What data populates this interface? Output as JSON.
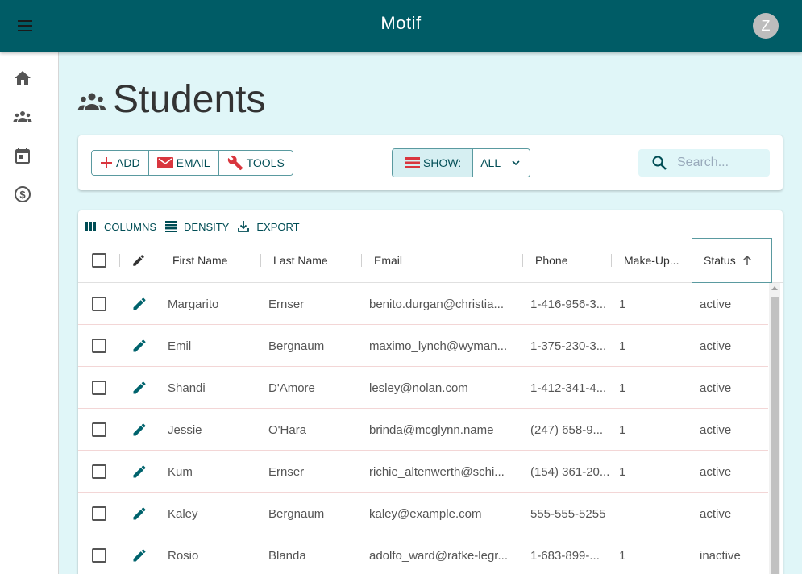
{
  "app": {
    "title": "Motif",
    "user_initial": "Z"
  },
  "sidebar": {
    "items": [
      {
        "icon": "home-icon"
      },
      {
        "icon": "people-icon"
      },
      {
        "icon": "calendar-icon"
      },
      {
        "icon": "dollar-icon"
      }
    ]
  },
  "page": {
    "title": "Students",
    "icon": "people-icon"
  },
  "toolbar": {
    "add_label": "ADD",
    "email_label": "EMAIL",
    "tools_label": "TOOLS",
    "show_label": "SHOW:",
    "show_value": "ALL",
    "search_placeholder": "Search..."
  },
  "grid_tools": {
    "columns_label": "COLUMNS",
    "density_label": "DENSITY",
    "export_label": "EXPORT"
  },
  "table": {
    "headers": {
      "first_name": "First Name",
      "last_name": "Last Name",
      "email": "Email",
      "phone": "Phone",
      "makeup": "Make-Up...",
      "status": "Status"
    },
    "rows": [
      {
        "first": "Margarito",
        "last": "Ernser",
        "email": "benito.durgan@christia...",
        "phone": "1-416-956-3...",
        "makeup": "1",
        "status": "active"
      },
      {
        "first": "Emil",
        "last": "Bergnaum",
        "email": "maximo_lynch@wyman...",
        "phone": "1-375-230-3...",
        "makeup": "1",
        "status": "active"
      },
      {
        "first": "Shandi",
        "last": "D'Amore",
        "email": "lesley@nolan.com",
        "phone": "1-412-341-4...",
        "makeup": "1",
        "status": "active"
      },
      {
        "first": "Jessie",
        "last": "O'Hara",
        "email": "brinda@mcglynn.name",
        "phone": "(247) 658-9...",
        "makeup": "1",
        "status": "active"
      },
      {
        "first": "Kum",
        "last": "Ernser",
        "email": "richie_altenwerth@schi...",
        "phone": "(154) 361-20...",
        "makeup": "1",
        "status": "active"
      },
      {
        "first": "Kaley",
        "last": "Bergnaum",
        "email": "kaley@example.com",
        "phone": "555-555-5255",
        "makeup": "",
        "status": "active"
      },
      {
        "first": "Rosio",
        "last": "Blanda",
        "email": "adolfo_ward@ratke-legr...",
        "phone": "1-683-899-...",
        "makeup": "1",
        "status": "inactive"
      }
    ]
  },
  "colors": {
    "brand": "#005c66",
    "background": "#e0f6f8",
    "accent_red": "#d9363e",
    "edit_icon": "#00636d"
  }
}
